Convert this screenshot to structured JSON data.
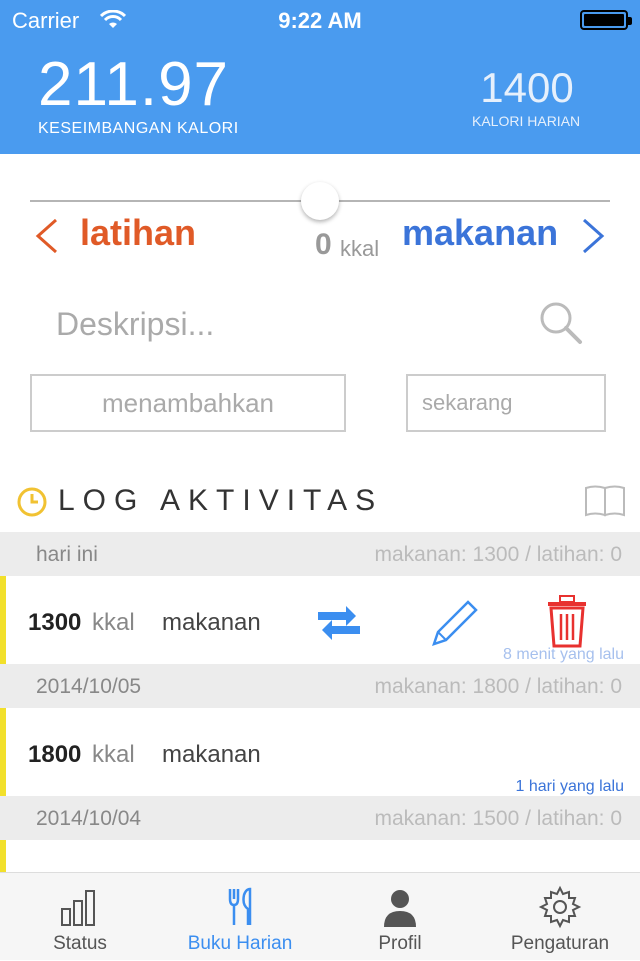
{
  "status_bar": {
    "carrier": "Carrier",
    "time": "9:22 AM"
  },
  "header": {
    "balance_value": "211.97",
    "balance_label": "KESEIMBANGAN KALORI",
    "daily_value": "1400",
    "daily_label": "KALORI HARIAN",
    "color": "#4a9bef"
  },
  "slider": {
    "left_label": "latihan",
    "right_label": "makanan",
    "value": "0",
    "unit": "kkal",
    "position": 0.5
  },
  "form": {
    "description_placeholder": "Deskripsi...",
    "amount_placeholder": "menambahkan",
    "time_placeholder": "sekarang"
  },
  "log": {
    "title": "LOG AKTIVITAS",
    "groups": [
      {
        "date": "hari ini",
        "summary": "makanan: 1300 / latihan: 0",
        "entry": {
          "amount": "1300",
          "unit": "kkal",
          "type": "makanan",
          "ago": "8 menit yang lalu"
        }
      },
      {
        "date": "2014/10/05",
        "summary": "makanan: 1800 / latihan: 0",
        "entry": {
          "amount": "1800",
          "unit": "kkal",
          "type": "makanan",
          "ago": "1 hari yang lalu"
        }
      },
      {
        "date": "2014/10/04",
        "summary": "makanan: 1500 / latihan: 0"
      }
    ]
  },
  "tabs": [
    {
      "label": "Status",
      "icon": "bar-chart-icon"
    },
    {
      "label": "Buku Harian",
      "icon": "fork-knife-icon",
      "active": true
    },
    {
      "label": "Profil",
      "icon": "person-icon"
    },
    {
      "label": "Pengaturan",
      "icon": "gear-icon"
    }
  ],
  "colors": {
    "accent": "#4a9bef",
    "latihan": "#e05a27",
    "makanan": "#3b74d9",
    "delete": "#e8312f",
    "entry_bar": "#f2e02b"
  }
}
